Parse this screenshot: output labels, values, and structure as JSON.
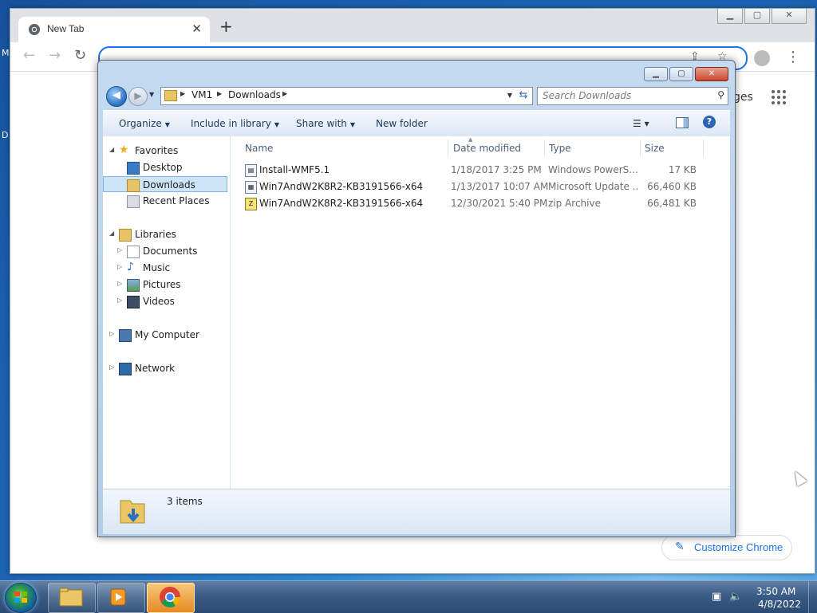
{
  "desktop": {
    "fragment_top": "M",
    "fragment_mid": "D"
  },
  "chrome": {
    "tab_title": "New Tab",
    "tab_close": "✕",
    "new_tab": "+",
    "win_min": "▁",
    "win_max": "▢",
    "win_close": "✕",
    "nav_back": "←",
    "nav_forward": "→",
    "nav_reload": "↻",
    "share_icon": "⇪",
    "star_icon": "☆",
    "kebab": "⋮",
    "side_text": "ges",
    "customize_icon": "✎",
    "customize_label": "Customize Chrome"
  },
  "explorer": {
    "caption": {
      "min": "▁",
      "max": "▢",
      "close": "✕"
    },
    "nav": {
      "back": "◀",
      "forward": "▶",
      "history": "▼"
    },
    "address": {
      "seg1": "VM1",
      "seg2": "Downloads",
      "arrow": "▶",
      "dropdown": "▼",
      "refresh": "⇆"
    },
    "search": {
      "placeholder": "Search Downloads",
      "icon": "⚲"
    },
    "commands": [
      {
        "label": "Organize",
        "dd": "▼"
      },
      {
        "label": "Include in library",
        "dd": "▼"
      },
      {
        "label": "Share with",
        "dd": "▼"
      },
      {
        "label": "New folder",
        "dd": ""
      }
    ],
    "view_icon": "☰ ▾",
    "help": "?",
    "nav_pane": {
      "favorites": "Favorites",
      "desktop": "Desktop",
      "downloads": "Downloads",
      "recent": "Recent Places",
      "libraries": "Libraries",
      "documents": "Documents",
      "music": "Music",
      "pictures": "Pictures",
      "videos": "Videos",
      "computer": "My Computer",
      "network": "Network",
      "expanded": "◢",
      "collapsed": "▷"
    },
    "columns": {
      "name": "Name",
      "date": "Date modified",
      "type": "Type",
      "size": "Size",
      "sort": "▲"
    },
    "files": [
      {
        "name": "Install-WMF5.1",
        "date": "1/18/2017 3:25 PM",
        "type": "Windows PowerS...",
        "size": "17 KB",
        "icon": "ps"
      },
      {
        "name": "Win7AndW2K8R2-KB3191566-x64",
        "date": "1/13/2017 10:07 AM",
        "type": "Microsoft Update ...",
        "size": "66,460 KB",
        "icon": "msu"
      },
      {
        "name": "Win7AndW2K8R2-KB3191566-x64",
        "date": "12/30/2021 5:40 PM",
        "type": "zip Archive",
        "size": "66,481 KB",
        "icon": "zip"
      }
    ],
    "status": {
      "items_count": "3 items"
    }
  },
  "taskbar": {
    "clock_time": "3:50 AM",
    "clock_date": "4/8/2022",
    "tray_network": "▣",
    "tray_volume": "🔈"
  },
  "colors": {
    "accent": "#1a73e8",
    "selection": "#cde6f7",
    "taskbar": "#3a5c86"
  }
}
